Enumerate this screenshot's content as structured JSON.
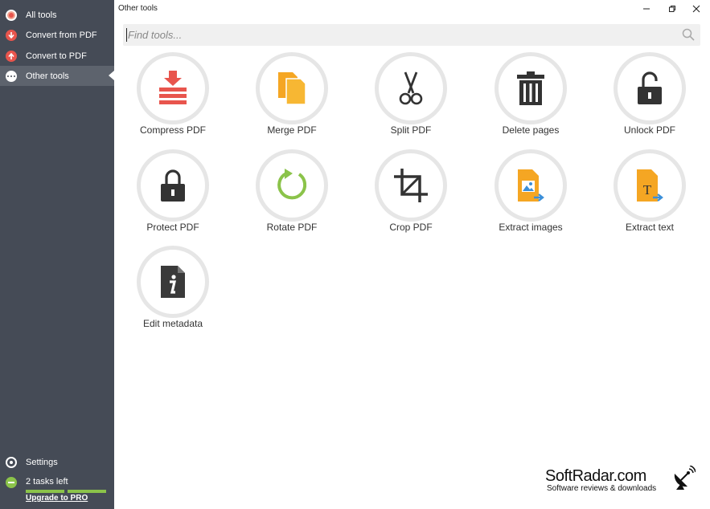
{
  "sidebar": {
    "items": [
      {
        "label": "All tools"
      },
      {
        "label": "Convert from PDF"
      },
      {
        "label": "Convert to PDF"
      },
      {
        "label": "Other tools"
      }
    ],
    "settings_label": "Settings",
    "tasks_label": "2 tasks left",
    "upgrade_label": "Upgrade to PRO"
  },
  "window": {
    "title": "Other tools"
  },
  "search": {
    "placeholder": "Find tools..."
  },
  "tools": [
    {
      "label": "Compress PDF",
      "icon": "compress-icon"
    },
    {
      "label": "Merge PDF",
      "icon": "merge-icon"
    },
    {
      "label": "Split PDF",
      "icon": "scissors-icon"
    },
    {
      "label": "Delete pages",
      "icon": "trash-icon"
    },
    {
      "label": "Unlock PDF",
      "icon": "unlock-icon"
    },
    {
      "label": "Protect PDF",
      "icon": "lock-icon"
    },
    {
      "label": "Rotate PDF",
      "icon": "rotate-icon"
    },
    {
      "label": "Crop PDF",
      "icon": "crop-icon"
    },
    {
      "label": "Extract images",
      "icon": "extract-images-icon"
    },
    {
      "label": "Extract text",
      "icon": "extract-text-icon"
    },
    {
      "label": "Edit metadata",
      "icon": "info-icon"
    }
  ],
  "watermark": {
    "title": "SoftRadar.com",
    "subtitle": "Software reviews & downloads"
  },
  "colors": {
    "sidebar": "#454b56",
    "red": "#e8554d",
    "orange": "#f5a623",
    "green": "#8bc34a",
    "dark": "#333333"
  }
}
